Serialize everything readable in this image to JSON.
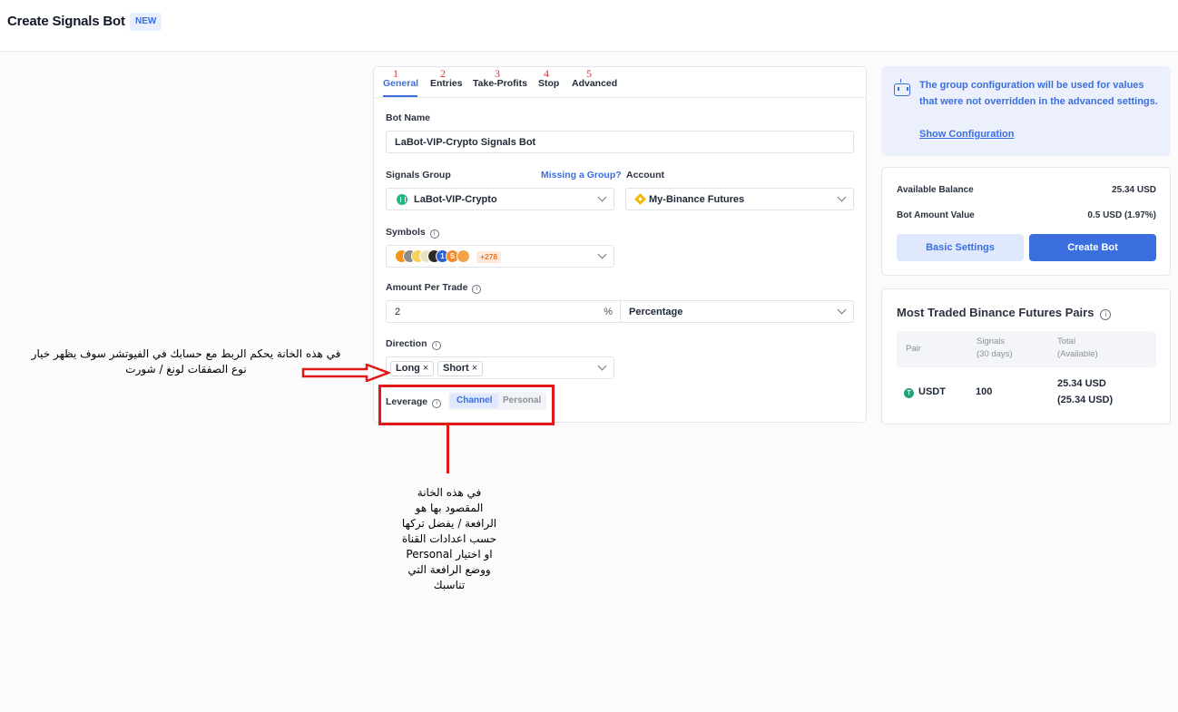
{
  "header": {
    "title": "Create Signals Bot",
    "badge": "NEW"
  },
  "tabs": [
    {
      "label": "General",
      "num": "1",
      "active": true
    },
    {
      "label": "Entries",
      "num": "2"
    },
    {
      "label": "Take-Profits",
      "num": "3"
    },
    {
      "label": "Stop",
      "num": "4"
    },
    {
      "label": "Advanced",
      "num": "5"
    }
  ],
  "form": {
    "bot_name_label": "Bot Name",
    "bot_name_value": "LaBot-VIP-Crypto Signals Bot",
    "signals_group_label": "Signals Group",
    "missing_group_link": "Missing a Group?",
    "signals_group_value": "LaBot-VIP-Crypto",
    "account_label": "Account",
    "account_value": "My-Binance Futures",
    "symbols_label": "Symbols",
    "symbols_more": "+278",
    "amount_label": "Amount Per Trade",
    "amount_value": "2",
    "amount_unit": "%",
    "amount_type": "Percentage",
    "direction_label": "Direction",
    "direction_tags": [
      "Long",
      "Short"
    ],
    "leverage_label": "Leverage",
    "leverage_options": [
      "Channel",
      "Personal"
    ],
    "leverage_selected": "Channel"
  },
  "info": {
    "text": "The group configuration will be used for values that were not overridden in the advanced settings.",
    "link": "Show Configuration"
  },
  "balance": {
    "available_label": "Available Balance",
    "available_value": "25.34 USD",
    "amount_label": "Bot Amount Value",
    "amount_value": "0.5 USD (1.97%)",
    "basic_settings": "Basic Settings",
    "create_bot": "Create Bot"
  },
  "pairs": {
    "title": "Most Traded Binance Futures Pairs",
    "headers": {
      "pair": "Pair",
      "signals": "Signals",
      "signals_sub": "(30 days)",
      "total": "Total",
      "total_sub": "(Available)"
    },
    "rows": [
      {
        "pair": "USDT",
        "signals": "100",
        "total": "25.34 USD",
        "available": "(25.34 USD)"
      }
    ]
  },
  "annotations": {
    "direction_note_line1": "في هذه الخانة يحكم الربط مع حسابك في الفيوتشر سوف يظهر خيار",
    "direction_note_line2": "نوع الصفقات لونغ / شورت",
    "leverage_note": [
      "في هذه الخانة",
      "المقصود بها هو",
      "الرافعة / يفضل تركها",
      "حسب اعدادات القناة",
      "او اختيار Personal",
      "ووضع الرافعة التي",
      "تناسبك"
    ]
  },
  "colors": {
    "accent": "#3b6fe0",
    "annotation": "#e01818"
  }
}
